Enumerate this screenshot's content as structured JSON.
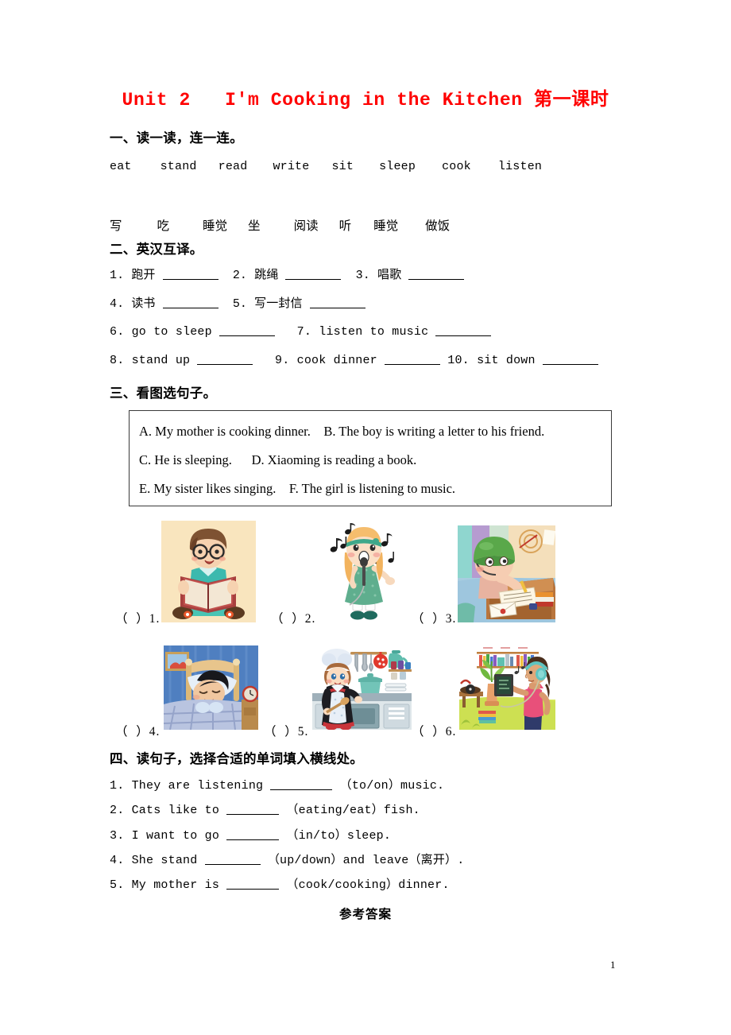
{
  "document": {
    "title": "Unit 2   I'm Cooking in the Kitchen 第一课时",
    "title_color": "#ff0000",
    "page_number": "1",
    "answer_heading": "参考答案"
  },
  "section1": {
    "heading": "一、读一读，连一连。",
    "english_words": [
      "eat",
      "stand",
      "read",
      "write",
      "sit",
      "sleep",
      "cook",
      "listen"
    ],
    "chinese_words": [
      "写",
      "吃",
      "睡觉",
      "坐",
      "阅读",
      "听",
      "睡觉",
      "做饭"
    ]
  },
  "section2": {
    "heading": "二、英汉互译。",
    "items": [
      {
        "num": "1.",
        "prompt": "跑开"
      },
      {
        "num": "2.",
        "prompt": "跳绳"
      },
      {
        "num": "3.",
        "prompt": "唱歌"
      },
      {
        "num": "4.",
        "prompt": "读书"
      },
      {
        "num": "5.",
        "prompt": "写一封信"
      },
      {
        "num": "6.",
        "prompt": "go to sleep"
      },
      {
        "num": "7.",
        "prompt": "listen to music"
      },
      {
        "num": "8.",
        "prompt": "stand up"
      },
      {
        "num": "9.",
        "prompt": "cook dinner"
      },
      {
        "num": "10.",
        "prompt": "sit down"
      }
    ]
  },
  "section3": {
    "heading": "三、看图选句子。",
    "choices": [
      {
        "letter": "A.",
        "text": "My mother is cooking dinner."
      },
      {
        "letter": "B.",
        "text": "The boy is writing a letter to his friend."
      },
      {
        "letter": "C.",
        "text": "He is sleeping."
      },
      {
        "letter": "D.",
        "text": "Xiaoming is reading a book."
      },
      {
        "letter": "E.",
        "text": "My sister likes singing."
      },
      {
        "letter": "F.",
        "text": "The girl is listening to music."
      }
    ],
    "box_lines": [
      "A. My mother is cooking dinner.    B. The boy is writing a letter to his friend.",
      "C. He is sleeping.      D. Xiaoming is reading a book.",
      "E. My sister likes singing.    F. The girl is listening to music."
    ],
    "pictures": [
      {
        "label": "（  ）1.",
        "description": "boy-reading-book"
      },
      {
        "label": "（  ）2.",
        "description": "girl-singing-microphone"
      },
      {
        "label": "（  ）3.",
        "description": "boy-writing-letter-at-desk"
      },
      {
        "label": "（  ）4.",
        "description": "boy-sleeping-in-bed"
      },
      {
        "label": "（  ）5.",
        "description": "woman-cooking-in-kitchen"
      },
      {
        "label": "（  ）6.",
        "description": "girl-listening-to-music-headphones"
      }
    ]
  },
  "section4": {
    "heading": "四、读句子，选择合适的单词填入横线处。",
    "items": [
      {
        "num": "1.",
        "before": "They are listening ",
        "after": " （to/on）music."
      },
      {
        "num": "2.",
        "before": "Cats like to ",
        "after": " （eating/eat）fish."
      },
      {
        "num": "3.",
        "before": "I want to go ",
        "after": " （in/to）sleep."
      },
      {
        "num": "4.",
        "before": "She stand ",
        "after": " （up/down）and leave（离开）."
      },
      {
        "num": "5.",
        "before": "My mother is ",
        "after": " （cook/cooking）dinner."
      }
    ]
  }
}
